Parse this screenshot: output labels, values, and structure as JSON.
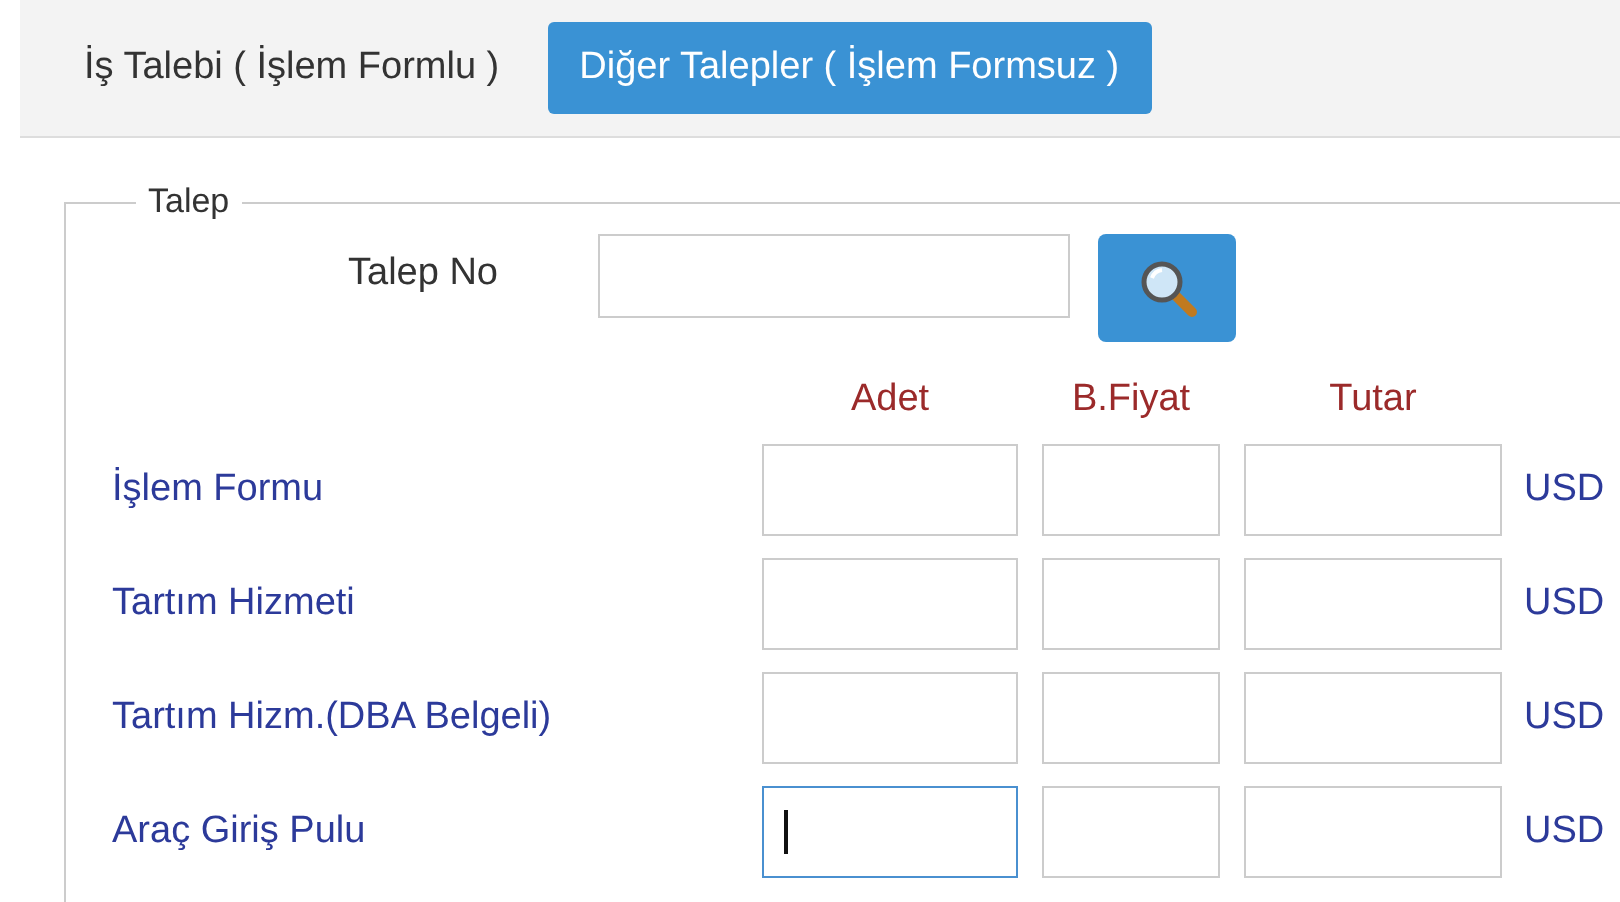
{
  "tabs": [
    {
      "label": "İş Talebi ( İşlem Formlu )",
      "selected": false
    },
    {
      "label": "Diğer Talepler ( İşlem Formsuz )",
      "selected": true
    }
  ],
  "fieldset": {
    "legend": "Talep",
    "request_no": {
      "label": "Talep No"
    }
  },
  "columns": [
    "Adet",
    "B.Fiyat",
    "Tutar"
  ],
  "rows": [
    {
      "label": "İşlem Formu",
      "currency": "USD",
      "focused": false
    },
    {
      "label": "Tartım Hizmeti",
      "currency": "USD",
      "focused": false
    },
    {
      "label": "Tartım Hizm.(DBA Belgeli)",
      "currency": "USD",
      "focused": false
    },
    {
      "label": "Araç Giriş Pulu",
      "currency": "USD",
      "focused": true
    }
  ]
}
